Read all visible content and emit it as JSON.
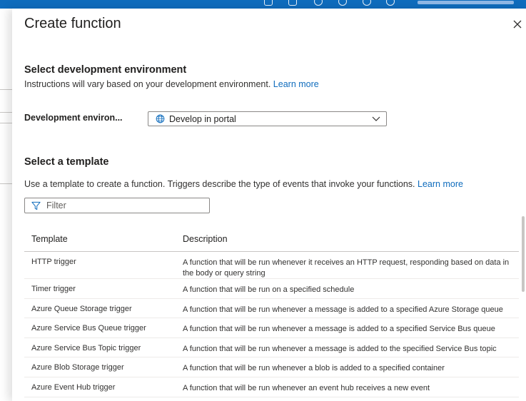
{
  "blade": {
    "title": "Create function",
    "close_icon": "close-icon"
  },
  "dev_env": {
    "heading": "Select development environment",
    "description": "Instructions will vary based on your development environment.",
    "learn_more": "Learn more",
    "field_label": "Development environ...",
    "selected_value": "Develop in portal",
    "icons": [
      "globe-icon",
      "chevron-down-icon"
    ]
  },
  "template_section": {
    "heading": "Select a template",
    "description": "Use a template to create a function. Triggers describe the type of events that invoke your functions.",
    "learn_more": "Learn more",
    "filter_placeholder": "Filter",
    "filter_icon": "filter-icon"
  },
  "table": {
    "columns": [
      "Template",
      "Description"
    ],
    "rows": [
      {
        "template": "HTTP trigger",
        "description": "A function that will be run whenever it receives an HTTP request, responding based on data in the body or query string"
      },
      {
        "template": "Timer trigger",
        "description": "A function that will be run on a specified schedule"
      },
      {
        "template": "Azure Queue Storage trigger",
        "description": "A function that will be run whenever a message is added to a specified Azure Storage queue"
      },
      {
        "template": "Azure Service Bus Queue trigger",
        "description": "A function that will be run whenever a message is added to a specified Service Bus queue"
      },
      {
        "template": "Azure Service Bus Topic trigger",
        "description": "A function that will be run whenever a message is added to the specified Service Bus topic"
      },
      {
        "template": "Azure Blob Storage trigger",
        "description": "A function that will be run whenever a blob is added to a specified container"
      },
      {
        "template": "Azure Event Hub trigger",
        "description": "A function that will be run whenever an event hub receives a new event"
      }
    ]
  },
  "colors": {
    "accent": "#0f6cbd",
    "text": "#323130",
    "border": "#8a8886"
  }
}
